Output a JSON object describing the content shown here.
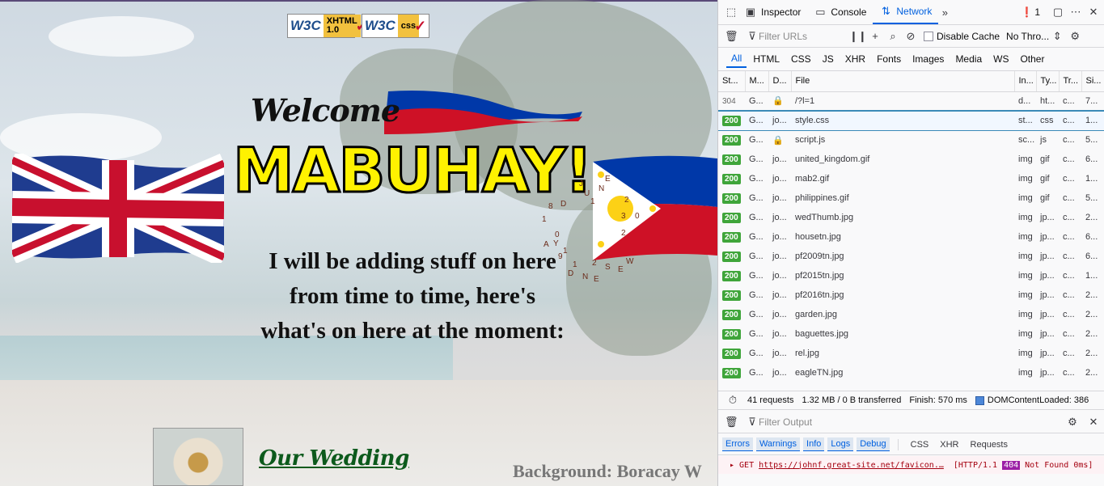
{
  "page": {
    "badges": [
      {
        "w3c": "W3C",
        "tag_line1": "XHTML",
        "tag_line2": "1.0"
      },
      {
        "w3c": "W3C",
        "tag_line1": "css",
        "tag_line2": ""
      }
    ],
    "welcome": "Welcome",
    "headline": "MABUHAY!",
    "intro_lines": [
      "I will be adding stuff on here",
      "from time to time, here's",
      "what's on here at the moment:"
    ],
    "wedding_link": "Our Wedding",
    "background_caption": "Background: Boracay W",
    "clock_chars": [
      "J",
      "U",
      "N",
      "E",
      "1",
      "2",
      "0",
      "2",
      "3",
      "S",
      "E",
      "N",
      "D",
      "E",
      "W",
      "D",
      "Y",
      "A",
      "9",
      "8",
      "1",
      "0",
      "1",
      "1",
      "2"
    ]
  },
  "devtools": {
    "tabs": [
      {
        "label": "Inspector"
      },
      {
        "label": "Console"
      },
      {
        "label": "Network"
      }
    ],
    "error_count": "1",
    "network_toolbar": {
      "filter_placeholder": "Filter URLs",
      "disable_cache": "Disable Cache",
      "throttle": "No Thro..."
    },
    "type_filters": [
      "All",
      "HTML",
      "CSS",
      "JS",
      "XHR",
      "Fonts",
      "Images",
      "Media",
      "WS",
      "Other"
    ],
    "columns": [
      "St...",
      "M...",
      "D...",
      "File",
      "In...",
      "Ty...",
      "Tr...",
      "Si..."
    ],
    "requests": [
      {
        "status": "304",
        "method": "G...",
        "domain": "",
        "file": "/?l=1",
        "initiator": "d...",
        "type": "ht...",
        "transferred": "c...",
        "size": "7..."
      },
      {
        "status": "200",
        "method": "G...",
        "domain": "jo...",
        "file": "style.css",
        "initiator": "st...",
        "type": "css",
        "transferred": "c...",
        "size": "1..."
      },
      {
        "status": "200",
        "method": "G...",
        "domain": "",
        "file": "script.js",
        "initiator": "sc...",
        "type": "js",
        "transferred": "c...",
        "size": "5..."
      },
      {
        "status": "200",
        "method": "G...",
        "domain": "jo...",
        "file": "united_kingdom.gif",
        "initiator": "img",
        "type": "gif",
        "transferred": "c...",
        "size": "6..."
      },
      {
        "status": "200",
        "method": "G...",
        "domain": "jo...",
        "file": "mab2.gif",
        "initiator": "img",
        "type": "gif",
        "transferred": "c...",
        "size": "1..."
      },
      {
        "status": "200",
        "method": "G...",
        "domain": "jo...",
        "file": "philippines.gif",
        "initiator": "img",
        "type": "gif",
        "transferred": "c...",
        "size": "5..."
      },
      {
        "status": "200",
        "method": "G...",
        "domain": "jo...",
        "file": "wedThumb.jpg",
        "initiator": "img",
        "type": "jp...",
        "transferred": "c...",
        "size": "2..."
      },
      {
        "status": "200",
        "method": "G...",
        "domain": "jo...",
        "file": "housetn.jpg",
        "initiator": "img",
        "type": "jp...",
        "transferred": "c...",
        "size": "6..."
      },
      {
        "status": "200",
        "method": "G...",
        "domain": "jo...",
        "file": "pf2009tn.jpg",
        "initiator": "img",
        "type": "jp...",
        "transferred": "c...",
        "size": "6..."
      },
      {
        "status": "200",
        "method": "G...",
        "domain": "jo...",
        "file": "pf2015tn.jpg",
        "initiator": "img",
        "type": "jp...",
        "transferred": "c...",
        "size": "1..."
      },
      {
        "status": "200",
        "method": "G...",
        "domain": "jo...",
        "file": "pf2016tn.jpg",
        "initiator": "img",
        "type": "jp...",
        "transferred": "c...",
        "size": "2..."
      },
      {
        "status": "200",
        "method": "G...",
        "domain": "jo...",
        "file": "garden.jpg",
        "initiator": "img",
        "type": "jp...",
        "transferred": "c...",
        "size": "2..."
      },
      {
        "status": "200",
        "method": "G...",
        "domain": "jo...",
        "file": "baguettes.jpg",
        "initiator": "img",
        "type": "jp...",
        "transferred": "c...",
        "size": "2..."
      },
      {
        "status": "200",
        "method": "G...",
        "domain": "jo...",
        "file": "rel.jpg",
        "initiator": "img",
        "type": "jp...",
        "transferred": "c...",
        "size": "2..."
      },
      {
        "status": "200",
        "method": "G...",
        "domain": "jo...",
        "file": "eagleTN.jpg",
        "initiator": "img",
        "type": "jp...",
        "transferred": "c...",
        "size": "2..."
      }
    ],
    "summary": {
      "requests": "41 requests",
      "transferred": "1.32 MB / 0 B transferred",
      "finish": "Finish: 570 ms",
      "dcl": "DOMContentLoaded: 386"
    },
    "console": {
      "filter_placeholder": "Filter Output",
      "chips": [
        "Errors",
        "Warnings",
        "Info",
        "Logs",
        "Debug"
      ],
      "extra_filters": [
        "CSS",
        "XHR",
        "Requests"
      ],
      "log": {
        "method": "GET",
        "url": "https://johnf.great-site.net/favicon.…",
        "proto": "[HTTP/1.1",
        "code": "404",
        "text": "Not Found 0ms]"
      }
    },
    "colors": {
      "accent": "#0060df",
      "status_ok": "#3fa53a",
      "error": "#d70022"
    }
  }
}
